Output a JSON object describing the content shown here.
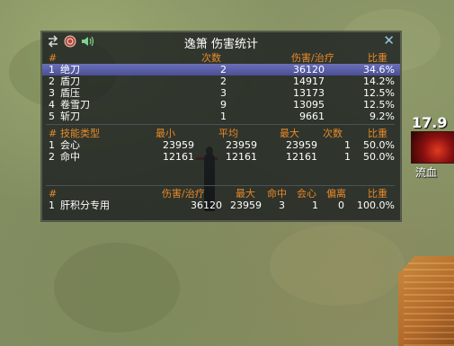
{
  "window": {
    "title": "逸箫 伤害统计"
  },
  "skills": {
    "headers": {
      "index": "#",
      "count": "次数",
      "dmg": "伤害/治疗",
      "ratio": "比重"
    },
    "rows": [
      {
        "idx": "1",
        "name": "绝刀",
        "count": "2",
        "dmg": "36120",
        "ratio": "34.6%",
        "selected": true
      },
      {
        "idx": "2",
        "name": "盾刀",
        "count": "2",
        "dmg": "14917",
        "ratio": "14.2%"
      },
      {
        "idx": "3",
        "name": "盾压",
        "count": "3",
        "dmg": "13173",
        "ratio": "12.5%"
      },
      {
        "idx": "4",
        "name": "卷雪刀",
        "count": "9",
        "dmg": "13095",
        "ratio": "12.5%"
      },
      {
        "idx": "5",
        "name": "斩刀",
        "count": "1",
        "dmg": "9661",
        "ratio": "9.2%"
      }
    ]
  },
  "hit_types": {
    "headers": {
      "index": "#",
      "type": "技能类型",
      "min": "最小",
      "avg": "平均",
      "max": "最大",
      "count": "次数",
      "ratio": "比重"
    },
    "rows": [
      {
        "idx": "1",
        "type": "会心",
        "min": "23959",
        "avg": "23959",
        "max": "23959",
        "count": "1",
        "ratio": "50.0%"
      },
      {
        "idx": "2",
        "type": "命中",
        "min": "12161",
        "avg": "12161",
        "max": "12161",
        "count": "1",
        "ratio": "50.0%"
      }
    ]
  },
  "targets": {
    "headers": {
      "index": "#",
      "dmg": "伤害/治疗",
      "max": "最大",
      "hit": "命中",
      "crit": "会心",
      "dev": "偏离",
      "ratio": "比重"
    },
    "rows": [
      {
        "idx": "1",
        "name": "肝积分专用",
        "dmg": "36120",
        "max": "23959",
        "hit": "3",
        "crit": "1",
        "dev": "0",
        "ratio": "100.0%"
      }
    ]
  },
  "buff": {
    "timer": "17.9",
    "label": "流血"
  },
  "colors": {
    "header_orange": "#e8892a",
    "selected_row": "#5b60a8",
    "panel_bg": "#161a1c"
  },
  "icons": [
    "swap-arrows-icon",
    "target-circle-icon",
    "speaker-icon",
    "close-icon",
    "bleed-buff-icon"
  ]
}
